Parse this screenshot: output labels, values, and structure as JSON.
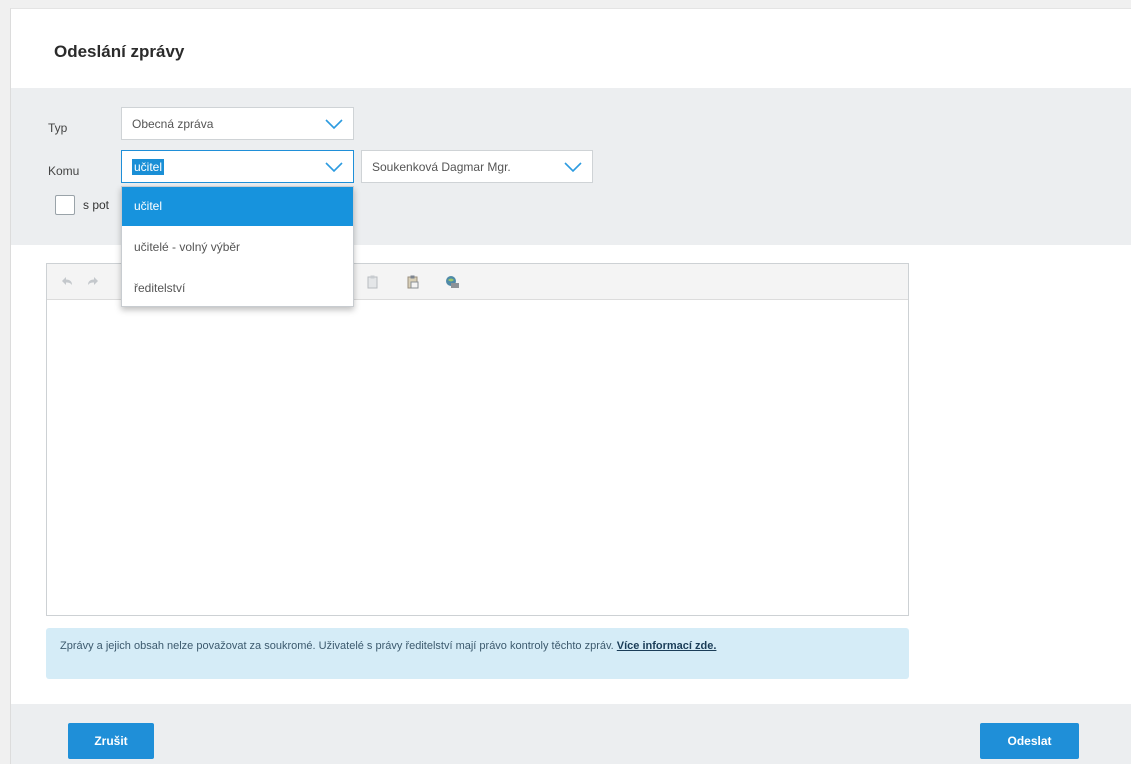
{
  "dialog": {
    "title": "Odeslání zprávy"
  },
  "form": {
    "type_label": "Typ",
    "type_value": "Obecná zpráva",
    "to_label": "Komu",
    "to_value": "učitel",
    "recipient_value": "Soukenková Dagmar Mgr.",
    "checkbox_label_visible": "s pot"
  },
  "dropdown": {
    "options": [
      {
        "label": "učitel",
        "selected": true
      },
      {
        "label": "učitelé - volný výběr",
        "selected": false
      },
      {
        "label": "ředitelství",
        "selected": false
      }
    ]
  },
  "editor": {
    "toolbar_icons": [
      "undo-icon",
      "redo-icon",
      "paste-icon",
      "paste-text-icon",
      "paste-word-icon"
    ],
    "content": ""
  },
  "notice": {
    "text": "Zprávy a jejich obsah nelze považovat za soukromé. Uživatelé s právy ředitelství mají právo kontroly těchto zpráv. ",
    "link": "Více informací zde."
  },
  "footer": {
    "cancel_label": "Zrušit",
    "send_label": "Odeslat"
  },
  "colors": {
    "accent": "#1f8fd8",
    "highlight": "#1793dd",
    "form_bg": "#eceef0",
    "notice_bg": "#d5ecf7"
  }
}
